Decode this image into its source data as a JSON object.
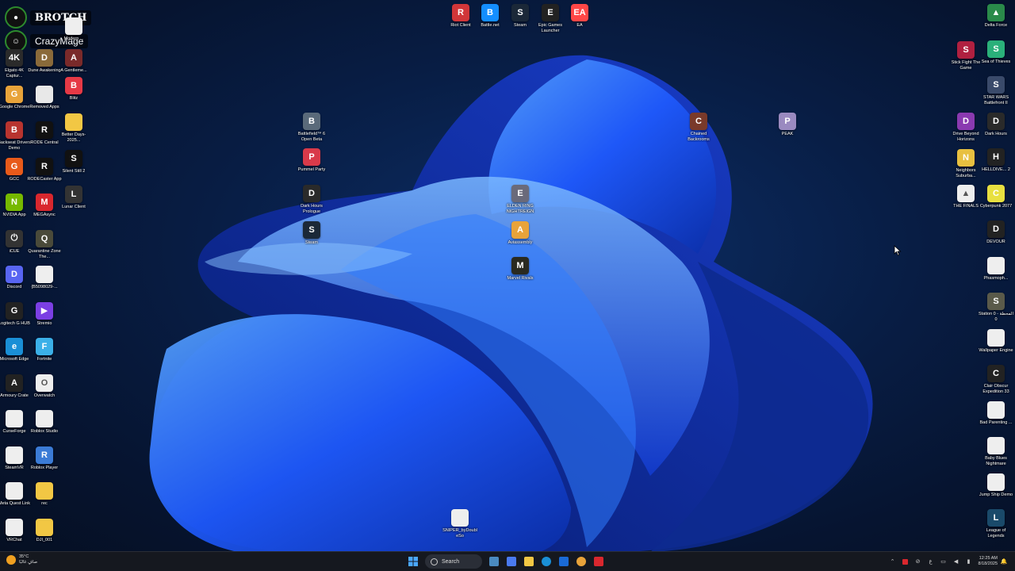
{
  "streamer": {
    "name_1": "BROTCH",
    "name_2": "CrazyMage"
  },
  "desktop_icons": {
    "col1": [
      {
        "label": "Elgato 4K Captur...",
        "color": "#2b2b2b",
        "glyph": "4K"
      },
      {
        "label": "Google Chrome",
        "color": "#e8a33a",
        "glyph": "G"
      },
      {
        "label": "Backseat Drivers Demo",
        "color": "#b8342f",
        "glyph": "B"
      },
      {
        "label": "GCC",
        "color": "#e85a1a",
        "glyph": "G"
      },
      {
        "label": "NVIDIA App",
        "color": "#76b900",
        "glyph": "N"
      },
      {
        "label": "iCUE",
        "color": "#333",
        "glyph": "⏻"
      },
      {
        "label": "Discord",
        "color": "#5865f2",
        "glyph": "D"
      },
      {
        "label": "Logitech G HUB",
        "color": "#222",
        "glyph": "G"
      },
      {
        "label": "Microsoft Edge",
        "color": "#1a8fd6",
        "glyph": "e"
      },
      {
        "label": "Armoury Crate",
        "color": "#222",
        "glyph": "A"
      },
      {
        "label": "CurseForge",
        "color": "#eee",
        "glyph": ""
      },
      {
        "label": "SteamVR",
        "color": "#eee",
        "glyph": ""
      },
      {
        "label": "Meta Quest Link",
        "color": "#eee",
        "glyph": ""
      },
      {
        "label": "VRChat",
        "color": "#eee",
        "glyph": ""
      }
    ],
    "col2": [
      {
        "label": "Dune Awakening",
        "color": "#8a6a3a",
        "glyph": "D"
      },
      {
        "label": "Removed Apps",
        "color": "#e8e8e8",
        "glyph": ""
      },
      {
        "label": "RODE Central",
        "color": "#111",
        "glyph": "R"
      },
      {
        "label": "RODECaster App",
        "color": "#111",
        "glyph": "R"
      },
      {
        "label": "MEGAsync",
        "color": "#d9272e",
        "glyph": "M"
      },
      {
        "label": "Quarantine Zone The...",
        "color": "#4a4a3a",
        "glyph": "Q"
      },
      {
        "label": "{B5098029-...",
        "color": "#eee",
        "glyph": ""
      },
      {
        "label": "Stremio",
        "color": "#7b3fe4",
        "glyph": "▶"
      },
      {
        "label": "Fortnite",
        "color": "#3bb0e8",
        "glyph": "F"
      },
      {
        "label": "Overwatch",
        "color": "#eee",
        "glyph": "O"
      },
      {
        "label": "Roblox Studio",
        "color": "#eee",
        "glyph": ""
      },
      {
        "label": "Roblox Player",
        "color": "#3b7bd6",
        "glyph": "R"
      },
      {
        "label": "rec",
        "color": "#f2c744",
        "glyph": ""
      },
      {
        "label": "DJI_001",
        "color": "#f2c744",
        "glyph": ""
      }
    ],
    "col3": [
      {
        "label": "Modern ...",
        "color": "#eee",
        "glyph": ""
      },
      {
        "label": "A Gentleme...",
        "color": "#7a2a2a",
        "glyph": "A"
      },
      {
        "label": "Blitz",
        "color": "#e63946",
        "glyph": "B"
      },
      {
        "label": "Better Days-2025...",
        "color": "#f2c744",
        "glyph": ""
      },
      {
        "label": "Silent Still 2",
        "color": "#111",
        "glyph": "S"
      },
      {
        "label": "Lunar Client",
        "color": "#333",
        "glyph": "L"
      }
    ],
    "top_row": [
      {
        "label": "Riot Client",
        "color": "#d13639",
        "glyph": "R"
      },
      {
        "label": "Battle.net",
        "color": "#148eff",
        "glyph": "B"
      },
      {
        "label": "Steam",
        "color": "#1b2838",
        "glyph": "S"
      },
      {
        "label": "Epic Games Launcher",
        "color": "#222",
        "glyph": "E"
      },
      {
        "label": "EA",
        "color": "#ff4747",
        "glyph": "EA"
      }
    ],
    "center": [
      {
        "label": "Battlefield™ 6 Open Beta",
        "color": "#5a6a7a",
        "glyph": "B"
      },
      {
        "label": "Pummel Party",
        "color": "#d93a4a",
        "glyph": "P"
      },
      {
        "label": "Dark Hours Prologue",
        "color": "#2a2a2a",
        "glyph": "D"
      },
      {
        "label": "Steam",
        "color": "#1b2838",
        "glyph": "S"
      },
      {
        "label": "ELDEN RING NIGHTREIGN",
        "color": "#6a6a7a",
        "glyph": "E"
      },
      {
        "label": "Aviassembly",
        "color": "#e8a33a",
        "glyph": "A"
      },
      {
        "label": "Marvel Rivals",
        "color": "#2a2a20",
        "glyph": "M"
      },
      {
        "label": "Chained Backrooms",
        "color": "#7a3a2a",
        "glyph": "C"
      },
      {
        "label": "PEAK",
        "color": "#9a8ac0",
        "glyph": "P"
      },
      {
        "label": "SNIPER_byDoubleSo",
        "color": "#eee",
        "glyph": ""
      }
    ],
    "right_col1": [
      {
        "label": "Stick Fight The Game",
        "color": "#b02040",
        "glyph": "S"
      },
      {
        "label": "Drive Beyond Horizons",
        "color": "#8a3ab0",
        "glyph": "D"
      },
      {
        "label": "Neighbors Suburba...",
        "color": "#e8c040",
        "glyph": "N"
      },
      {
        "label": "THE FINALS",
        "color": "#eee",
        "glyph": "▲"
      }
    ],
    "right_col2": [
      {
        "label": "Delta Force",
        "color": "#2a8a4a",
        "glyph": "▲"
      },
      {
        "label": "Sea of Thieves",
        "color": "#2ab07a",
        "glyph": "S"
      },
      {
        "label": "STAR WARS Battlefront II",
        "color": "#3a4a6a",
        "glyph": "S"
      },
      {
        "label": "Dark Hours",
        "color": "#2a2a2a",
        "glyph": "D"
      },
      {
        "label": "HELLDIVE... 2",
        "color": "#222",
        "glyph": "H"
      },
      {
        "label": "Cyberpunk 2077",
        "color": "#e8e040",
        "glyph": "C"
      },
      {
        "label": "DEVOUR",
        "color": "#222",
        "glyph": "D"
      },
      {
        "label": "Phasmoph...",
        "color": "#eee",
        "glyph": ""
      },
      {
        "label": "Station 0 - المحطة 0",
        "color": "#5a5a4a",
        "glyph": "S"
      },
      {
        "label": "Wallpaper Engine",
        "color": "#eee",
        "glyph": ""
      },
      {
        "label": "Clair Obscur Expedition 33",
        "color": "#222",
        "glyph": "C"
      },
      {
        "label": "Bad Parenting ...",
        "color": "#eee",
        "glyph": ""
      },
      {
        "label": "Baby Blues Nightmare",
        "color": "#eee",
        "glyph": ""
      },
      {
        "label": "Jump Ship Demo",
        "color": "#eee",
        "glyph": ""
      },
      {
        "label": "League of Legends",
        "color": "#1a4a6a",
        "glyph": "L"
      }
    ]
  },
  "taskbar": {
    "weather_temp": "35°C",
    "weather_desc": "صافٍ غالبًا",
    "search_label": "Search",
    "lang": "ع",
    "time": "12:25 AM",
    "date": "8/18/2025",
    "apps": [
      {
        "name": "windows",
        "color": "#3a9ae8"
      },
      {
        "name": "widgets",
        "color": "#4a8ac0"
      },
      {
        "name": "taskview",
        "color": "#4a7af0"
      },
      {
        "name": "explorer",
        "color": "#f2c744"
      },
      {
        "name": "edge",
        "color": "#1a8fd6"
      },
      {
        "name": "outlook",
        "color": "#1a6ad6"
      },
      {
        "name": "chrome",
        "color": "#e8a33a"
      },
      {
        "name": "gmail",
        "color": "#d9272e"
      }
    ]
  },
  "colors": {
    "accent": "#1f5bff",
    "taskbar_bg": "#15181f"
  }
}
